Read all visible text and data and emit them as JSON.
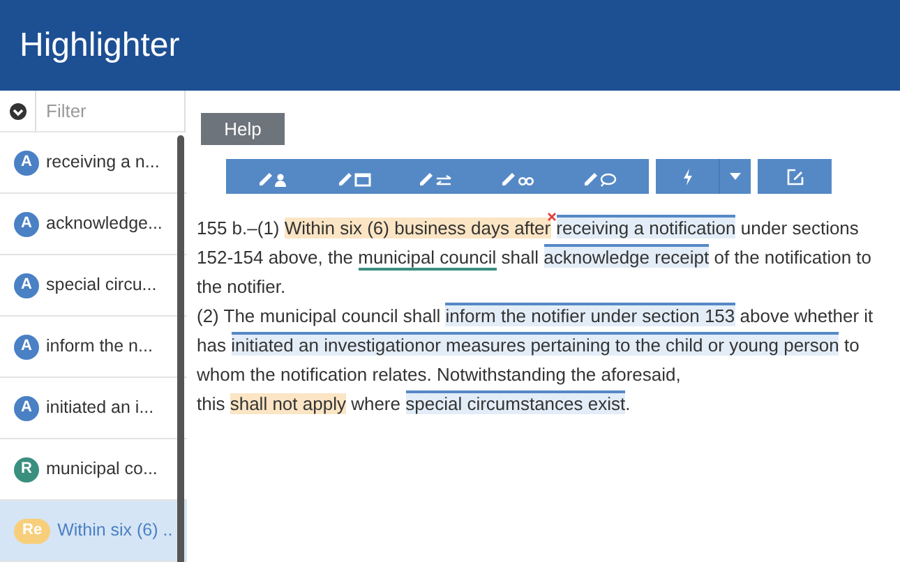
{
  "app": {
    "title": "Highlighter"
  },
  "filter": {
    "placeholder": "Filter"
  },
  "annotations": [
    {
      "badge": "A",
      "label": "receiving a n...",
      "kind": "a",
      "selected": false
    },
    {
      "badge": "A",
      "label": "acknowledge...",
      "kind": "a",
      "selected": false
    },
    {
      "badge": "A",
      "label": "special circu...",
      "kind": "a",
      "selected": false
    },
    {
      "badge": "A",
      "label": "inform the n...",
      "kind": "a",
      "selected": false
    },
    {
      "badge": "A",
      "label": "initiated an i...",
      "kind": "a",
      "selected": false
    },
    {
      "badge": "R",
      "label": "municipal co...",
      "kind": "r",
      "selected": false
    },
    {
      "badge": "Re",
      "label": "Within six (6) ..",
      "kind": "re",
      "selected": true
    }
  ],
  "help_button": "Help",
  "document": [
    {
      "text": "155 b.–(1) ",
      "kind": "plain"
    },
    {
      "text": "Within six (6) business days after",
      "kind": "re",
      "removable": true
    },
    {
      "text": "receiving a notification",
      "kind": "a"
    },
    {
      "text": " under sections 152-154 above, the ",
      "kind": "plain"
    },
    {
      "text": "municipal council",
      "kind": "r"
    },
    {
      "text": " shall ",
      "kind": "plain"
    },
    {
      "text": "acknowledge receipt",
      "kind": "a"
    },
    {
      "text": " of the notification to the notifier.",
      "kind": "plain"
    },
    {
      "kind": "break"
    },
    {
      "text": "(2) The municipal council shall ",
      "kind": "plain"
    },
    {
      "text": "inform the notifier under section 153",
      "kind": "a"
    },
    {
      "text": " above whether it has ",
      "kind": "plain"
    },
    {
      "text": "initiated an investigationor measures pertaining to the child or young person",
      "kind": "a"
    },
    {
      "text": " to whom the notification relates. Notwithstanding the aforesaid,",
      "kind": "plain"
    },
    {
      "kind": "break"
    },
    {
      "text": "this ",
      "kind": "plain"
    },
    {
      "text": "shall not apply",
      "kind": "re"
    },
    {
      "text": " where ",
      "kind": "plain"
    },
    {
      "text": "special circumstances exist",
      "kind": "a"
    },
    {
      "text": ".",
      "kind": "plain"
    }
  ]
}
